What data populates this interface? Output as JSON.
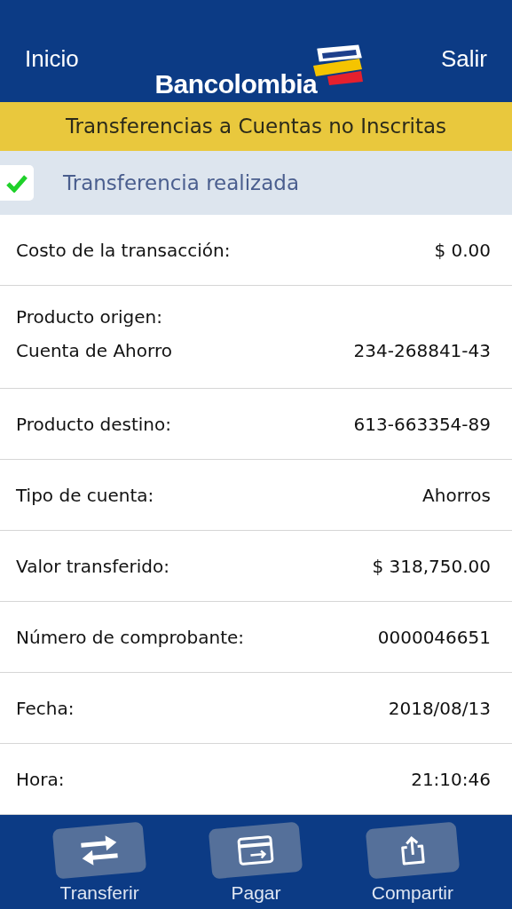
{
  "header": {
    "left_link": "Inicio",
    "logo": "Bancolombia",
    "right_link": "Salir"
  },
  "title": "Transferencias a Cuentas no Inscritas",
  "status": {
    "text": "Transferencia realizada",
    "success": true
  },
  "details": [
    {
      "kind": "single",
      "label": "Costo de la transacción:",
      "value": "$ 0.00"
    },
    {
      "kind": "double",
      "label": "Producto origen:",
      "sublabel": "Cuenta de Ahorro",
      "value": "234-268841-43"
    },
    {
      "kind": "single",
      "label": "Producto destino:",
      "value": "613-663354-89"
    },
    {
      "kind": "single",
      "label": "Tipo de cuenta:",
      "value": "Ahorros"
    },
    {
      "kind": "single",
      "label": "Valor transferido:",
      "value": "$ 318,750.00"
    },
    {
      "kind": "single",
      "label": "Número de comprobante:",
      "value": "0000046651"
    },
    {
      "kind": "single",
      "label": "Fecha:",
      "value": "2018/08/13"
    },
    {
      "kind": "single",
      "label": "Hora:",
      "value": "21:10:46"
    }
  ],
  "actions": [
    {
      "kind": "transfer",
      "label": "Transferir"
    },
    {
      "kind": "pay",
      "label": "Pagar"
    },
    {
      "kind": "share",
      "label": "Compartir"
    }
  ]
}
